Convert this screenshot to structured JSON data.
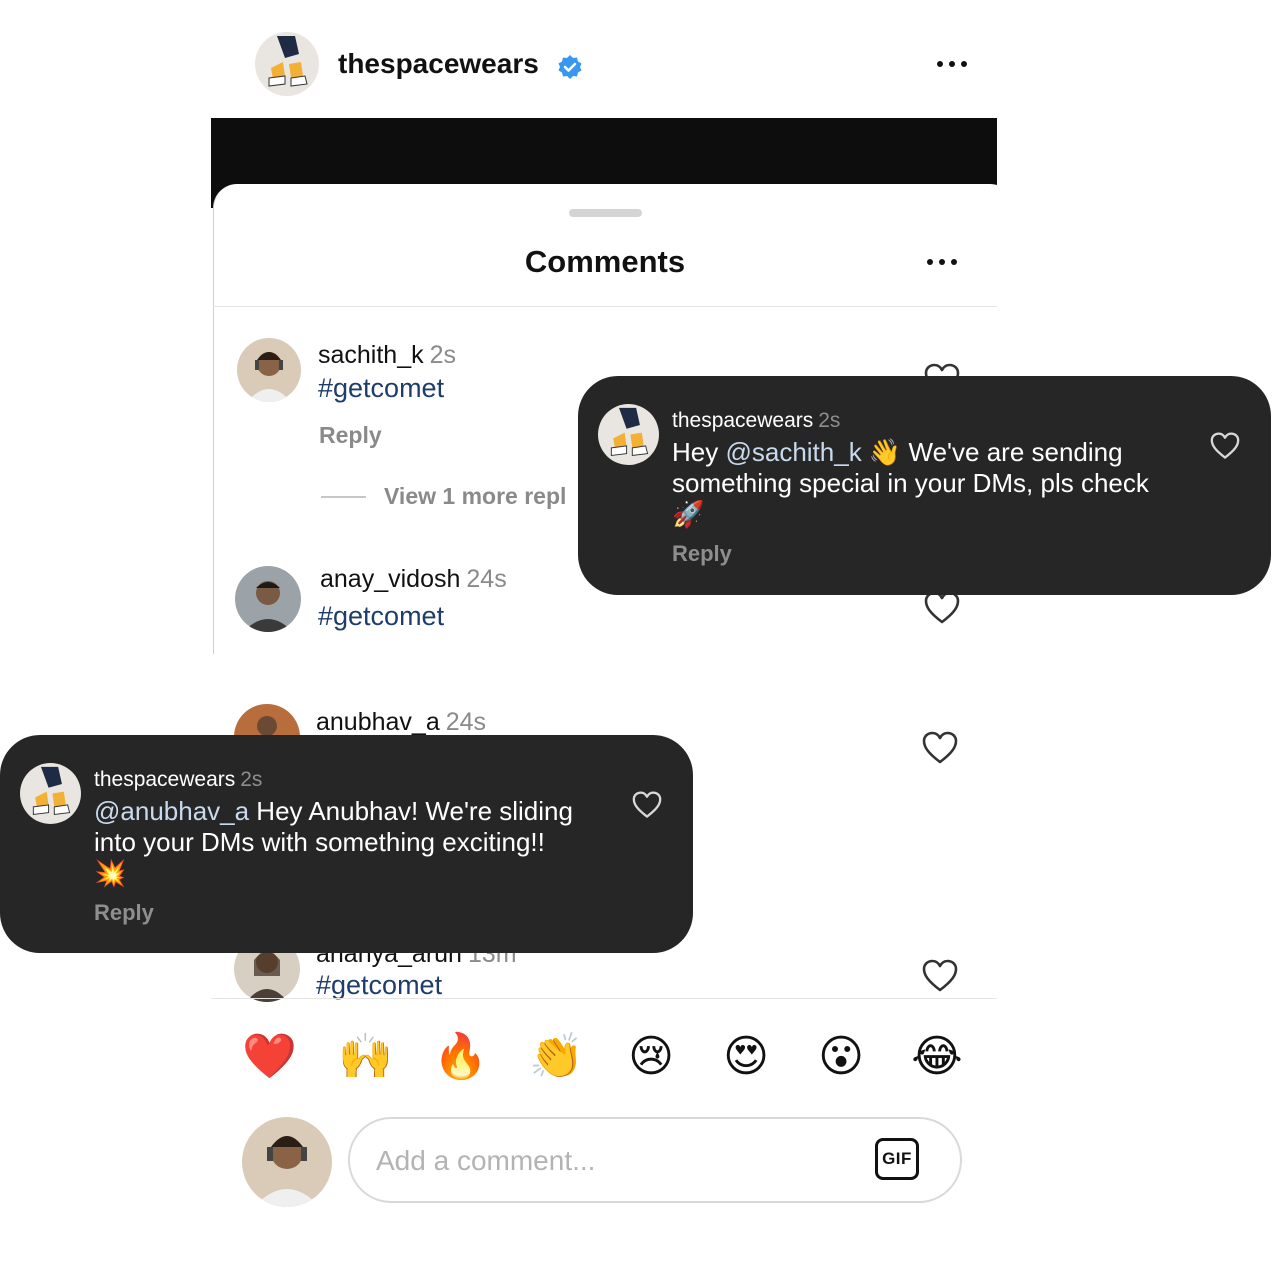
{
  "post": {
    "account_name": "thespacewears",
    "verified": true,
    "more_icon": "more-horizontal-icon"
  },
  "comments_sheet": {
    "title": "Comments",
    "more_icon": "more-horizontal-icon",
    "view_more_label": "View 1 more repl",
    "comments": [
      {
        "username": "sachith_k",
        "time": "2s",
        "text": "#getcomet",
        "reply_label": "Reply"
      },
      {
        "username": "anay_vidosh",
        "time": "24s",
        "text": "#getcomet"
      },
      {
        "username": "anubhav_a",
        "time": "24s"
      },
      {
        "username": "ananya_arun",
        "time": "13m",
        "text": "#getcomet"
      }
    ]
  },
  "reply_bubbles": [
    {
      "username": "thespacewears",
      "time": "2s",
      "mention": "@sachith_k",
      "text_before": "Hey ",
      "text_after": " 👋 We've are sending something special in your DMs, pls check 🚀",
      "reply_label": "Reply"
    },
    {
      "username": "thespacewears",
      "time": "2s",
      "mention": "@anubhav_a",
      "text_before": "",
      "text_after": " Hey Anubhav!  We're sliding into your DMs with something exciting!! 💥",
      "reply_label": "Reply"
    }
  ],
  "emoji_bar": [
    "❤️",
    "🙌",
    "🔥",
    "👏",
    "😢",
    "😍",
    "😮",
    "😂"
  ],
  "composer": {
    "placeholder": "Add a comment...",
    "gif_label": "GIF"
  },
  "colors": {
    "hashtag": "#1e3d6b",
    "bubble_bg": "#262626",
    "verified_blue": "#3897f0",
    "muted": "#8a8a8a"
  }
}
